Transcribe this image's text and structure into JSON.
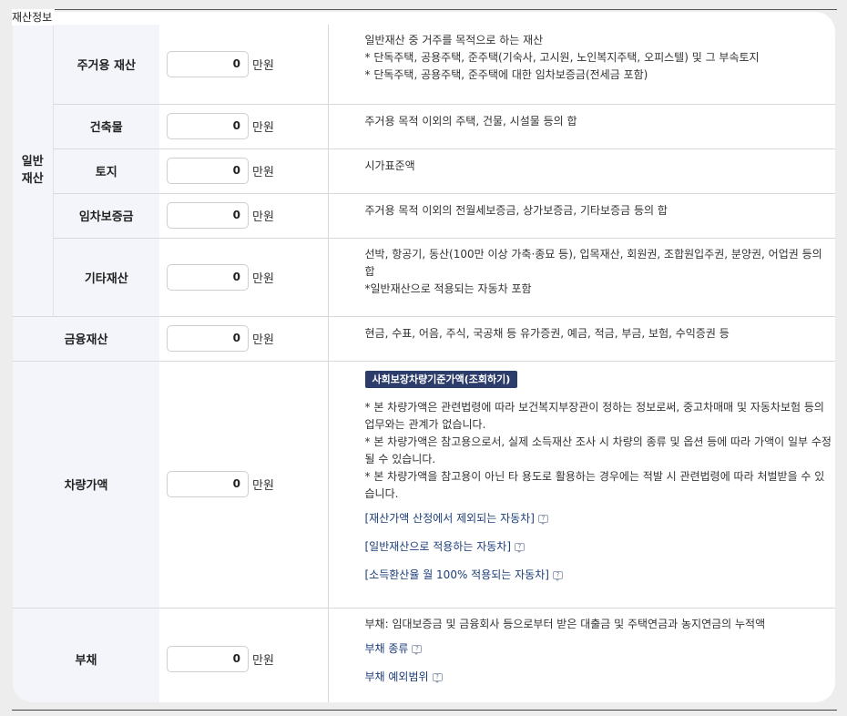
{
  "section_title": "재산정보",
  "unit_label": "만원",
  "general_property": {
    "group_label": "일반재산",
    "rows": [
      {
        "label": "주거용 재산",
        "amount": "0",
        "desc": [
          "일반재산 중 거주를 목적으로 하는 재산",
          "* 단독주택, 공용주택, 준주택(기숙사, 고시원, 노인복지주택, 오피스텔) 및 그 부속토지",
          "* 단독주택, 공용주택, 준주택에 대한 임차보증금(전세금 포함)"
        ]
      },
      {
        "label": "건축물",
        "amount": "0",
        "desc": [
          "주거용 목적 이외의 주택, 건물, 시설물 등의 합"
        ]
      },
      {
        "label": "토지",
        "amount": "0",
        "desc": [
          "시가표준액"
        ]
      },
      {
        "label": "임차보증금",
        "amount": "0",
        "desc": [
          "주거용 목적 이외의 전월세보증금, 상가보증금, 기타보증금 등의 합"
        ]
      },
      {
        "label": "기타재산",
        "amount": "0",
        "desc": [
          "선박, 항공기, 동산(100만 이상 가축·종묘 등), 입목재산, 회원권, 조합원입주권, 분양권, 어업권 등의 합",
          "*일반재산으로 적용되는 자동차 포함"
        ]
      }
    ]
  },
  "financial": {
    "label": "금융재산",
    "amount": "0",
    "desc": "현금, 수표, 어음, 주식, 국공채 등 유가증권, 예금, 적금, 부금, 보험, 수익증권 등"
  },
  "vehicle": {
    "label": "차량가액",
    "amount": "0",
    "lookup_button": "사회보장차량기준가액(조회하기)",
    "notes": [
      "* 본 차량가액은 관련법령에 따라 보건복지부장관이 정하는 정보로써, 중고차매매 및 자동차보험 등의 업무와는 관계가 없습니다.",
      "* 본 차량가액은 참고용으로서, 실제 소득재산 조사 시 차량의 종류 및 옵션 등에 따라 가액이 일부 수정될 수 있습니다.",
      "* 본 차량가액을 참고용이 아닌 타 용도로 활용하는 경우에는 적발 시 관련법령에 따라 처벌받을 수 있습니다."
    ],
    "links": [
      "[재산가액 산정에서 제외되는 자동차]",
      "[일반재산으로 적용하는 자동차]",
      "[소득환산율 월 100% 적용되는 자동차]"
    ]
  },
  "debt": {
    "label": "부채",
    "amount": "0",
    "desc": "부채: 임대보증금 및 금융회사 등으로부터 받은 대출금 및 주택연금과 농지연금의 누적액",
    "links": [
      "부채 종류",
      "부채 예외범위"
    ]
  },
  "help_icon_text": "?"
}
